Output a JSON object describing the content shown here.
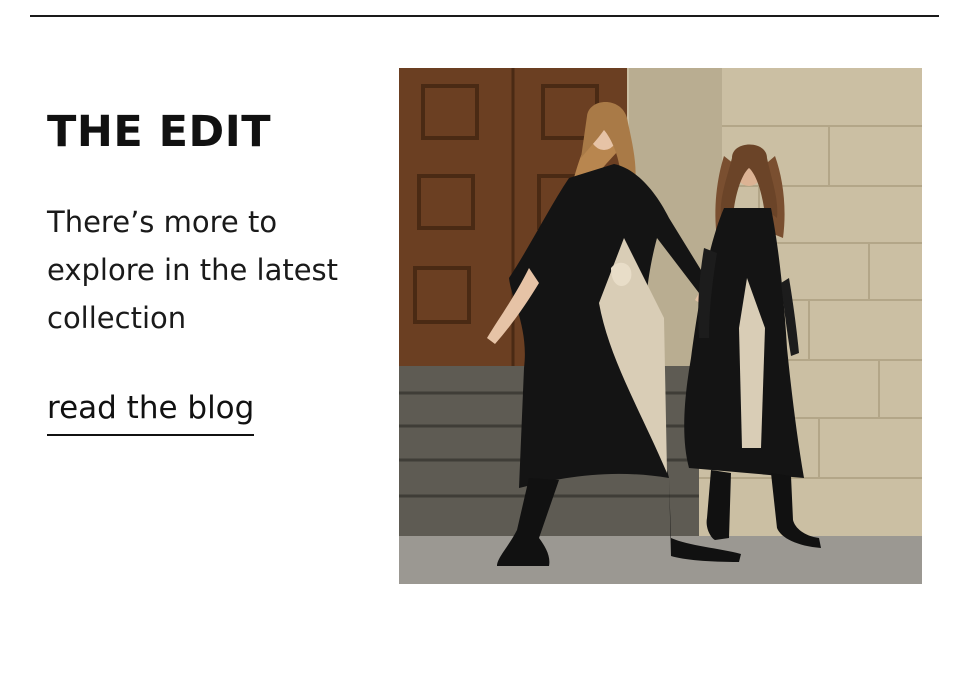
{
  "section": {
    "heading": "THE EDIT",
    "subtext": "There’s more to explore in the latest collection",
    "link_label": "read the blog"
  },
  "image": {
    "description_icon": "fashion-photo",
    "colors": {
      "door": "#6b3f22",
      "wall": "#cfc3a8",
      "steps": "#5d5a52",
      "pavement": "#9b9892",
      "dress": "#141414",
      "pattern": "#d9cdb6"
    }
  }
}
